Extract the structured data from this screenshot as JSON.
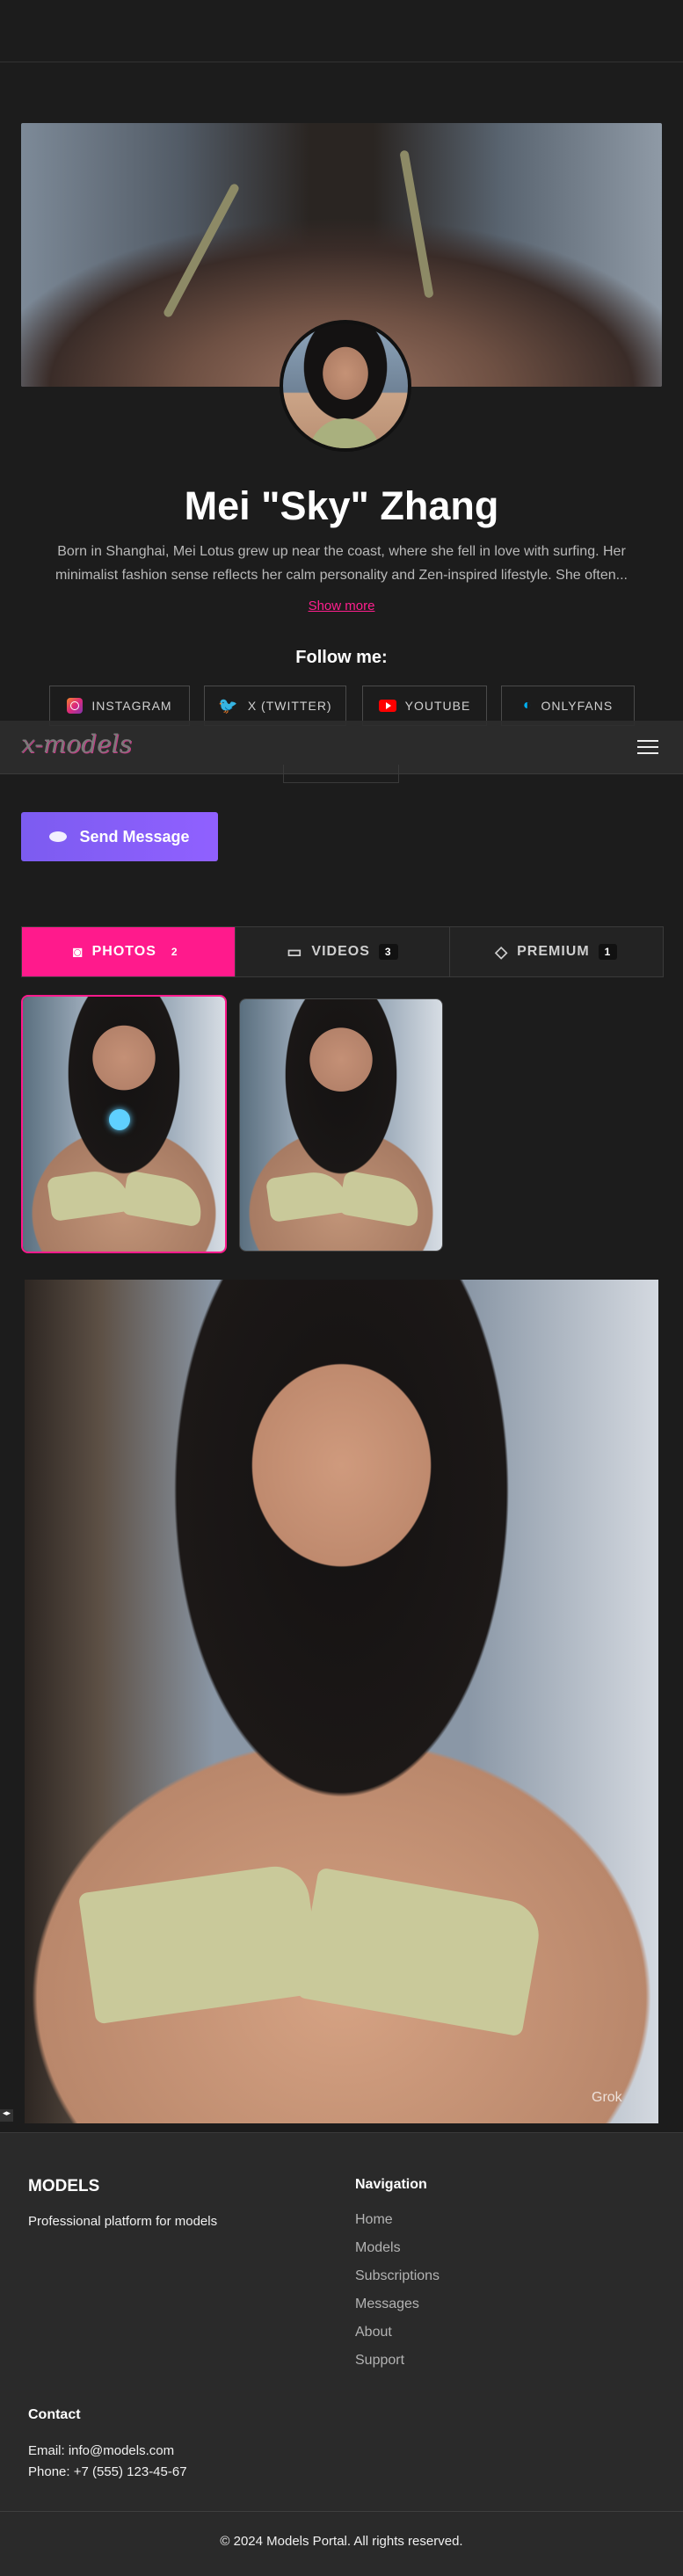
{
  "profile": {
    "name": "Mei \"Sky\" Zhang",
    "bio": "Born in Shanghai, Mei Lotus grew up near the coast, where she fell in love with surfing. Her minimalist fashion sense reflects her calm personality and Zen-inspired lifestyle. She often...",
    "show_more": "Show more"
  },
  "social": {
    "title": "Follow me:",
    "links": [
      {
        "label": "INSTAGRAM",
        "icon": "instagram-icon"
      },
      {
        "label": "X (TWITTER)",
        "icon": "twitter-bird-icon"
      },
      {
        "label": "YOUTUBE",
        "icon": "youtube-icon"
      },
      {
        "label": "ONLYFANS",
        "icon": "onlyfans-icon"
      }
    ]
  },
  "nav": {
    "logo": "x-models",
    "menu_icon": "hamburger-menu-icon"
  },
  "send_message": {
    "label": "Send Message",
    "icon": "message-bubble-icon"
  },
  "tabs": [
    {
      "label": "PHOTOS",
      "count": "2",
      "icon": "camera-icon",
      "active": true
    },
    {
      "label": "VIDEOS",
      "count": "3",
      "icon": "video-camera-icon",
      "active": false
    },
    {
      "label": "PREMIUM",
      "count": "1",
      "icon": "diamond-icon",
      "active": false
    }
  ],
  "photo": {
    "watermark": "Grok"
  },
  "footer": {
    "brand": "MODELS",
    "tagline": "Professional platform for models",
    "nav_title": "Navigation",
    "nav_items": [
      "Home",
      "Models",
      "Subscriptions",
      "Messages",
      "About",
      "Support"
    ],
    "contact_title": "Contact",
    "email": "Email: info@models.com",
    "phone": "Phone: +7 (555) 123-45-67",
    "copyright": "© 2024 Models Portal. All rights reserved."
  },
  "colors": {
    "accent_pink": "#ff1a8c",
    "send_purple": "#8a5cf6",
    "background": "#1c1c1c"
  }
}
